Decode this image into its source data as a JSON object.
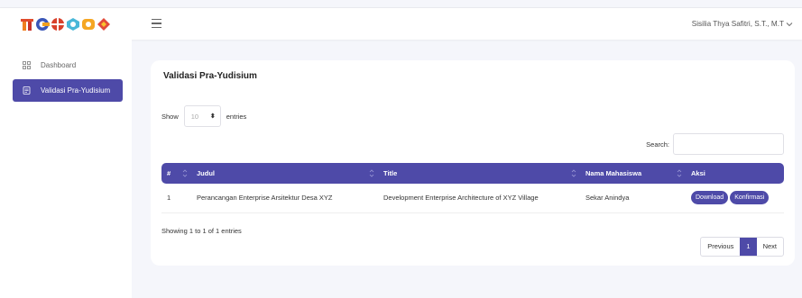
{
  "header": {
    "logo_icon": "telkom-logo",
    "menu_icon": "hamburger-menu-icon",
    "user_name": "Sisilia Thya Safitri, S.T., M.T",
    "user_menu_icon": "chevron-down-icon"
  },
  "sidebar": {
    "items": [
      {
        "label": "Dashboard",
        "icon": "grid-icon",
        "active": false
      },
      {
        "label": "Validasi Pra-Yudisium",
        "icon": "document-icon",
        "active": true
      }
    ]
  },
  "main": {
    "title": "Validasi Pra-Yudisium",
    "length": {
      "show_label": "Show",
      "value": "10",
      "entries_label": "entries"
    },
    "search": {
      "label": "Search:",
      "value": ""
    },
    "table": {
      "columns": [
        "#",
        "Judul",
        "Title",
        "Nama Mahasiswa",
        "Aksi"
      ],
      "rows": [
        {
          "no": "1",
          "judul": "Perancangan Enterprise Arsitektur Desa XYZ",
          "title": "Development Enterprise Architecture of XYZ Village",
          "nama": "Sekar Anindya",
          "actions": [
            "Download",
            "Konfirmasi"
          ]
        }
      ]
    },
    "info": "Showing 1 to 1 of 1 entries",
    "pagination": {
      "previous": "Previous",
      "current": "1",
      "next": "Next"
    }
  },
  "colors": {
    "accent": "#4e4aa8",
    "background": "#f5f6fb"
  }
}
